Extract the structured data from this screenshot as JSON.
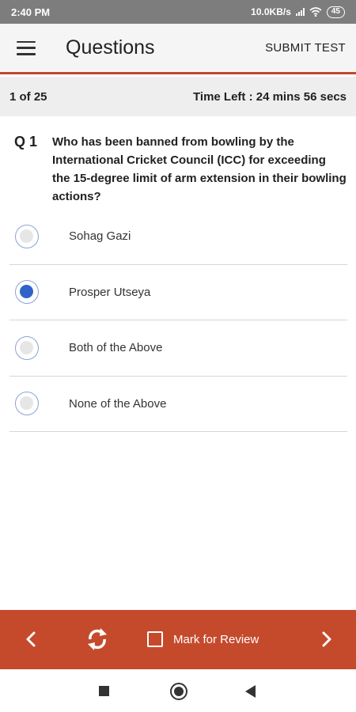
{
  "status_bar": {
    "time": "2:40 PM",
    "network_speed": "10.0KB/s",
    "battery": "45",
    "icons": [
      "signal-icon",
      "wifi-icon",
      "battery-icon"
    ]
  },
  "app_bar": {
    "title": "Questions",
    "submit_label": "SUBMIT TEST",
    "menu_icon": "hamburger-menu-icon"
  },
  "info_bar": {
    "progress": "1 of 25",
    "time_left": "Time Left : 24 mins 56 secs"
  },
  "question": {
    "number": "Q 1",
    "text": "Who has been banned from bowling by the International Cricket Council (ICC) for exceeding the 15-degree limit of arm extension in their bowling actions?",
    "options": [
      {
        "label": "Sohag Gazi",
        "selected": false
      },
      {
        "label": "Prosper Utseya",
        "selected": true
      },
      {
        "label": "Both of the Above",
        "selected": false
      },
      {
        "label": "None of the Above",
        "selected": false
      }
    ]
  },
  "action_bar": {
    "mark_review_label": "Mark for Review",
    "mark_review_checked": false,
    "icons": [
      "chevron-left-icon",
      "refresh-icon",
      "checkbox-icon",
      "chevron-right-icon"
    ]
  },
  "colors": {
    "accent": "#c54a2c",
    "radio_selected": "#2f63c9",
    "status_bar": "#7d7d7d"
  }
}
